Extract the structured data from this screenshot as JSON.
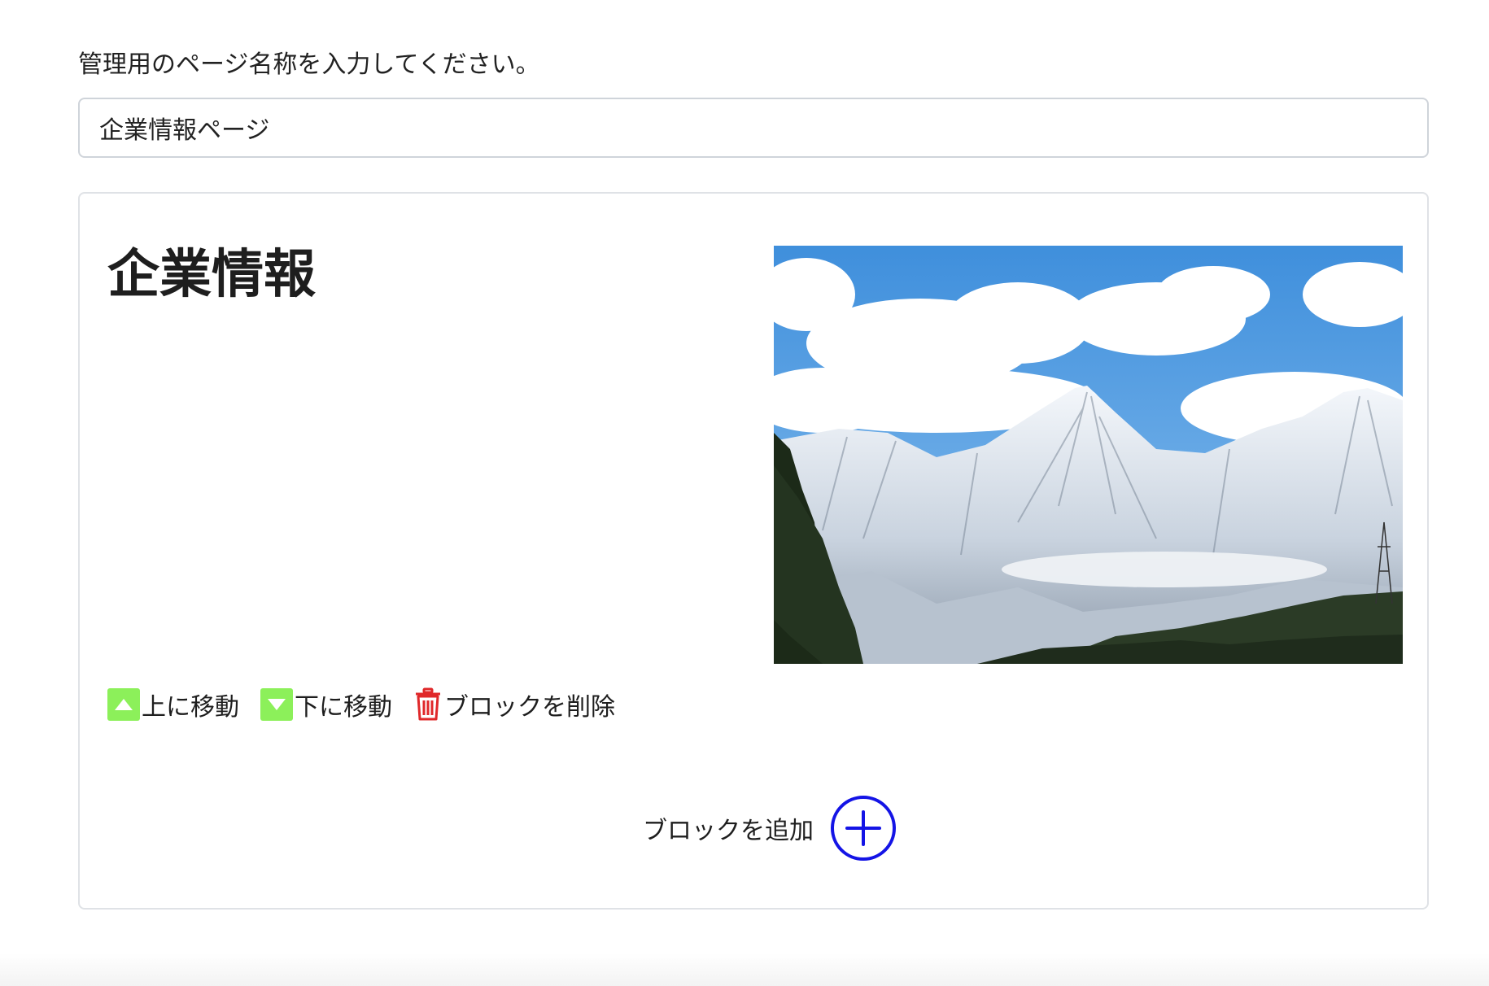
{
  "form": {
    "label": "管理用のページ名称を入力してください。",
    "page_name_value": "企業情報ページ"
  },
  "block": {
    "heading": "企業情報",
    "image_subject": "snow-capped mountain landscape with clouds and forest",
    "actions": {
      "move_up_label": "上に移動",
      "move_down_label": "下に移動",
      "delete_label": "ブロックを削除"
    }
  },
  "add_block": {
    "label": "ブロックを追加"
  },
  "icons": {
    "move_up": "triangle-up-icon",
    "move_down": "triangle-down-icon",
    "delete": "trash-icon",
    "add": "plus-circle-icon"
  },
  "colors": {
    "arrow_button_bg": "#8cf05a",
    "trash_icon": "#e0282a",
    "add_icon": "#1414e6",
    "input_border": "#cfd4da",
    "card_border": "#dfe2e6"
  }
}
